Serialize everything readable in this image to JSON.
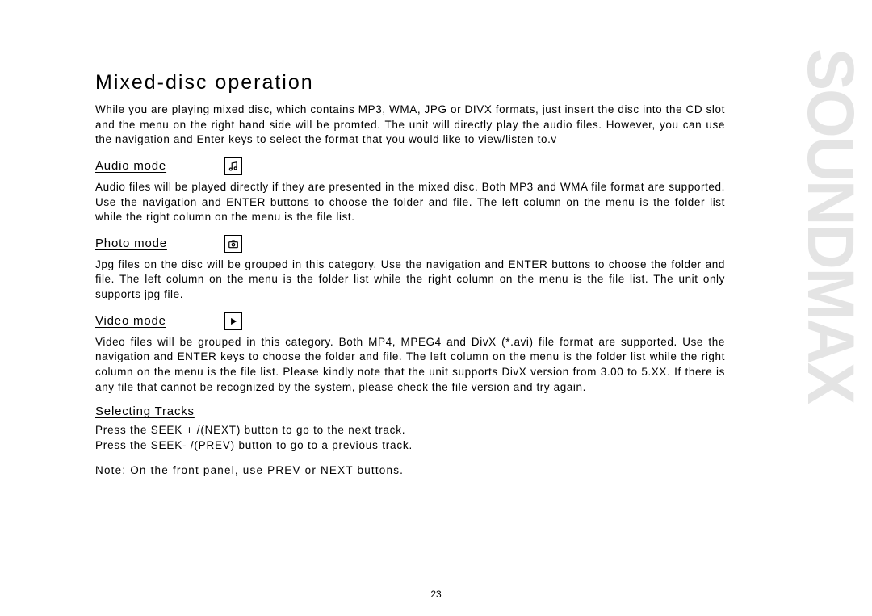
{
  "title": "Mixed-disc operation",
  "intro": "While you are playing mixed disc, which contains MP3, WMA, JPG or DIVX formats, just insert the disc into the CD slot and the menu on the right hand side will be promted. The unit will directly play the audio files. However, you can use the navigation and Enter keys to select the format that you would like to view/listen to.v",
  "audio": {
    "heading": "Audio mode",
    "body": "Audio files will be played directly if they are presented in the mixed disc. Both MP3 and WMA file format are supported. Use the navigation and ENTER buttons to choose the folder and file. The left column on the menu is the folder list while the right column on the menu is the file list."
  },
  "photo": {
    "heading": "Photo mode",
    "body": "Jpg files on the disc will be grouped in this category. Use the navigation and ENTER buttons to choose the folder and file. The left column on the menu is the folder list while the right column on the menu is the file list. The unit only supports jpg file."
  },
  "video": {
    "heading": "Video mode",
    "body": "Video files will be grouped in this category. Both MP4, MPEG4 and DivX (*.avi) file format are supported. Use the navigation and ENTER keys to choose the folder and file. The left column on the menu is the folder list while the right column on the menu is the file list. Please kindly note that the unit supports DivX version from 3.00 to 5.XX. If there is any file that cannot be recognized by the system, please check the file version and try again."
  },
  "tracks": {
    "heading": "Selecting Tracks",
    "line1": "Press the SEEK + /(NEXT) button to go to the next track.",
    "line2": "Press the SEEK- /(PREV) button to go to a previous track.",
    "note": "Note: On the front panel, use PREV or NEXT buttons."
  },
  "page_number": "23",
  "brand": "SOUNDMAX"
}
